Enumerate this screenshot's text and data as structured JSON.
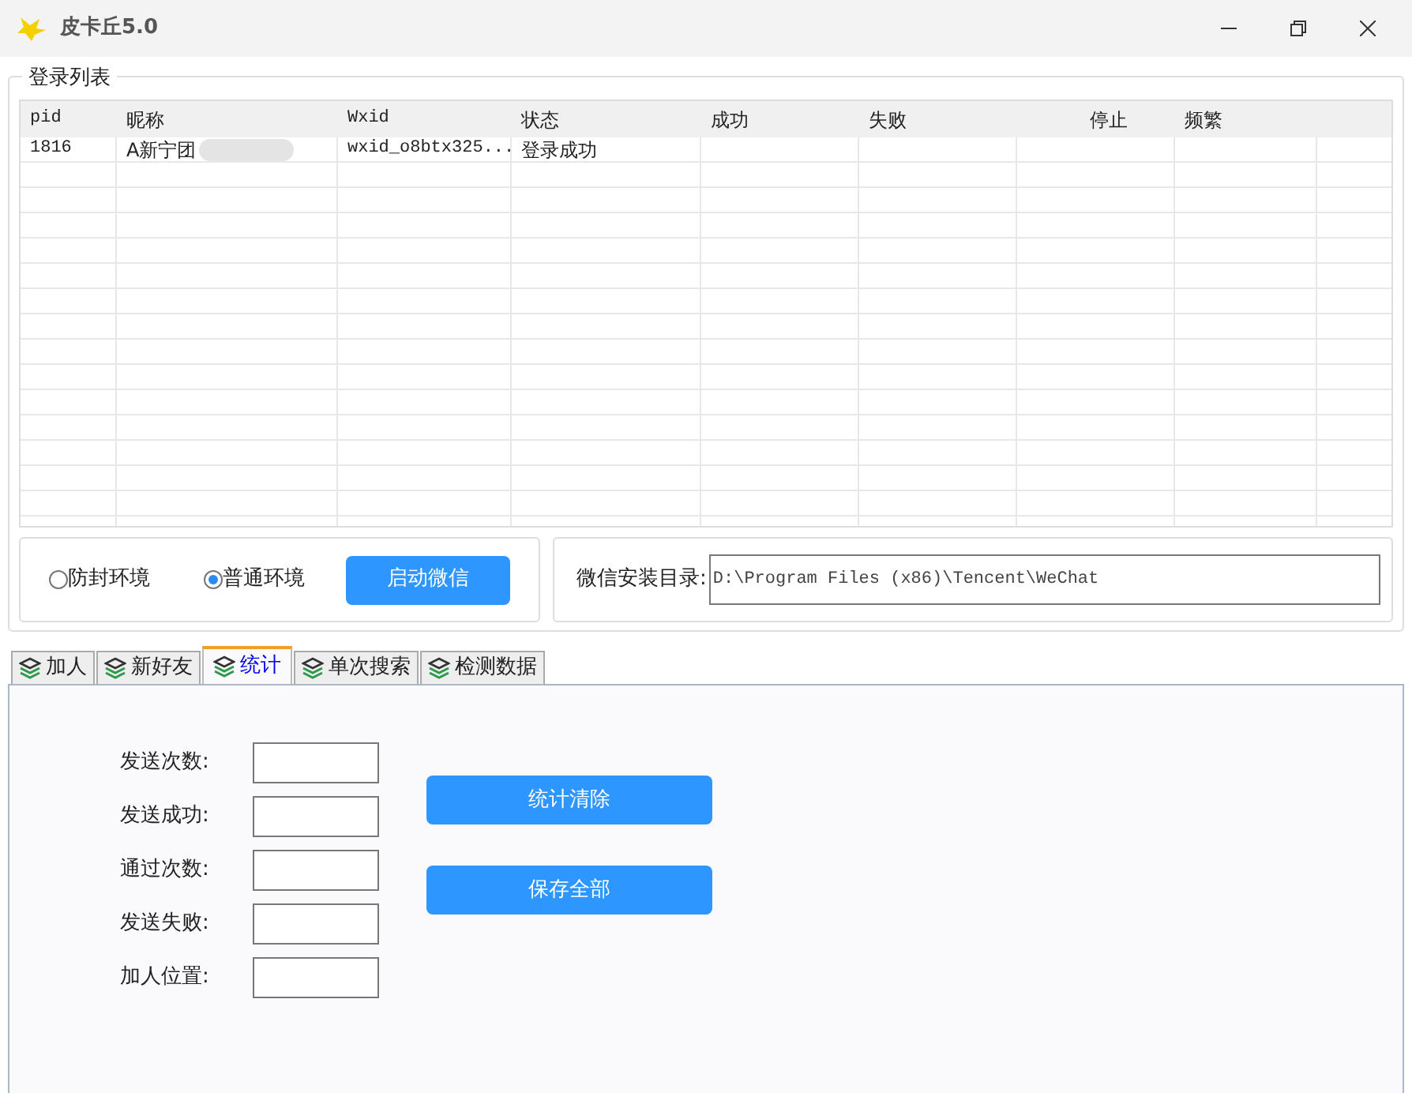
{
  "window": {
    "title": "皮卡丘5.0"
  },
  "login_list": {
    "title": "登录列表",
    "columns": [
      "pid",
      "昵称",
      "Wxid",
      "状态",
      "成功",
      "失败",
      "停止",
      "频繁"
    ],
    "rows": [
      {
        "cells": [
          "1816",
          "A新宁团",
          "wxid_o8btx325...",
          "登录成功",
          "",
          "",
          "",
          ""
        ]
      }
    ]
  },
  "environment": [
    {
      "label": "防封环境",
      "selected": false
    },
    {
      "label": "普通环境",
      "selected": true
    }
  ],
  "start_button": "启动微信",
  "install_dir": {
    "label": "微信安装目录:",
    "value": "D:\\Program Files (x86)\\Tencent\\WeChat"
  },
  "tabs": [
    {
      "label": "加人",
      "selected": false
    },
    {
      "label": "新好友",
      "selected": false
    },
    {
      "label": "统计",
      "selected": true
    },
    {
      "label": "单次搜索",
      "selected": false
    },
    {
      "label": "检测数据",
      "selected": false
    }
  ],
  "stats": {
    "fields": [
      {
        "label": "发送次数:"
      },
      {
        "label": "发送成功:"
      },
      {
        "label": "通过次数:"
      },
      {
        "label": "发送失败:"
      },
      {
        "label": "加人位置:"
      }
    ],
    "buttons": [
      "统计清除",
      "保存全部"
    ]
  }
}
